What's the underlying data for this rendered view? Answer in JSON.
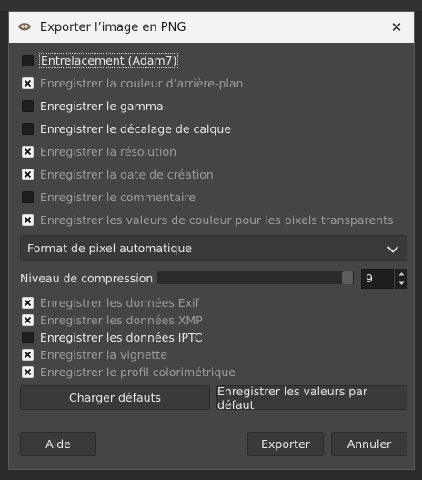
{
  "window": {
    "title": "Exporter l’image en PNG"
  },
  "options": [
    {
      "label": "Entrelacement (Adam7)",
      "checked": false,
      "active": true
    },
    {
      "label": "Enregistrer la couleur d’arrière-plan",
      "checked": true,
      "active": false
    },
    {
      "label": "Enregistrer le gamma",
      "checked": false,
      "active": true
    },
    {
      "label": "Enregistrer le décalage de calque",
      "checked": false,
      "active": true
    },
    {
      "label": "Enregistrer la résolution",
      "checked": true,
      "active": false
    },
    {
      "label": "Enregistrer la date de création",
      "checked": true,
      "active": false
    },
    {
      "label": "Enregistrer le commentaire",
      "checked": false,
      "active": false
    },
    {
      "label": "Enregistrer les valeurs de couleur pour les pixels transparents",
      "checked": true,
      "active": false
    }
  ],
  "pixel_format": {
    "selected": "Format de pixel automatique"
  },
  "compression": {
    "label": "Niveau de compression :",
    "value": "9",
    "level": 1.0
  },
  "metadata": [
    {
      "label": "Enregistrer les données Exif",
      "checked": true,
      "active": false
    },
    {
      "label": "Enregistrer les données XMP",
      "checked": true,
      "active": false
    },
    {
      "label": "Enregistrer les données IPTC",
      "checked": false,
      "active": true
    },
    {
      "label": "Enregistrer la vignette",
      "checked": true,
      "active": false
    },
    {
      "label": "Enregistrer le profil colorimétrique",
      "checked": true,
      "active": false
    }
  ],
  "buttons": {
    "load_defaults": "Charger défauts",
    "save_defaults": "Enregistrer les valeurs par défaut",
    "help": "Aide",
    "export": "Exporter",
    "cancel": "Annuler"
  }
}
